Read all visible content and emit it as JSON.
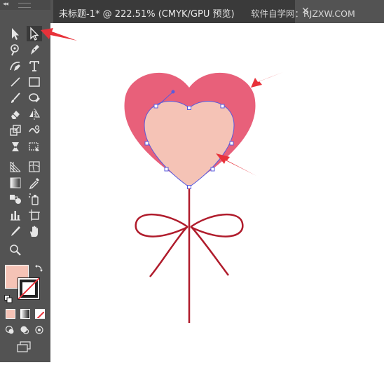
{
  "document_tab": {
    "title": "未标题-1* @ 222.51% (CMYK/GPU 预览)",
    "close_glyph": "✕"
  },
  "watermark": "软件自学网：RJZXW.COM",
  "colors": {
    "toolbar_bg": "#535353",
    "fill_swatch": "#f5c3b6",
    "heart_outer": "#e8607a",
    "heart_inner": "#f5c3b6",
    "path_selection": "#5a5adc",
    "stem": "#b01c2c",
    "arrow": "#e8323a"
  },
  "tools": [
    {
      "name": "selection-tool-icon"
    },
    {
      "name": "direct-selection-tool-icon",
      "active": true
    },
    {
      "name": "magic-wand-tool-icon"
    },
    {
      "name": "pen-tool-icon"
    },
    {
      "name": "curvature-tool-icon"
    },
    {
      "name": "type-tool-icon"
    },
    {
      "name": "line-segment-tool-icon"
    },
    {
      "name": "rectangle-tool-icon"
    },
    {
      "name": "paintbrush-tool-icon"
    },
    {
      "name": "shaper-tool-icon"
    },
    {
      "name": "eraser-tool-icon"
    },
    {
      "name": "reflect-tool-icon"
    },
    {
      "name": "scale-tool-icon"
    },
    {
      "name": "warp-tool-icon"
    },
    {
      "name": "puppet-warp-tool-icon"
    },
    {
      "name": "free-transform-tool-icon"
    },
    {
      "name": "perspective-grid-tool-icon"
    },
    {
      "name": "mesh-tool-icon"
    },
    {
      "name": "gradient-tool-icon"
    },
    {
      "name": "eyedropper-tool-icon"
    },
    {
      "name": "blend-tool-icon"
    },
    {
      "name": "symbol-sprayer-tool-icon"
    },
    {
      "name": "column-graph-tool-icon"
    },
    {
      "name": "artboard-tool-icon"
    },
    {
      "name": "slice-tool-icon"
    },
    {
      "name": "hand-tool-icon"
    },
    {
      "name": "zoom-tool-icon"
    }
  ]
}
